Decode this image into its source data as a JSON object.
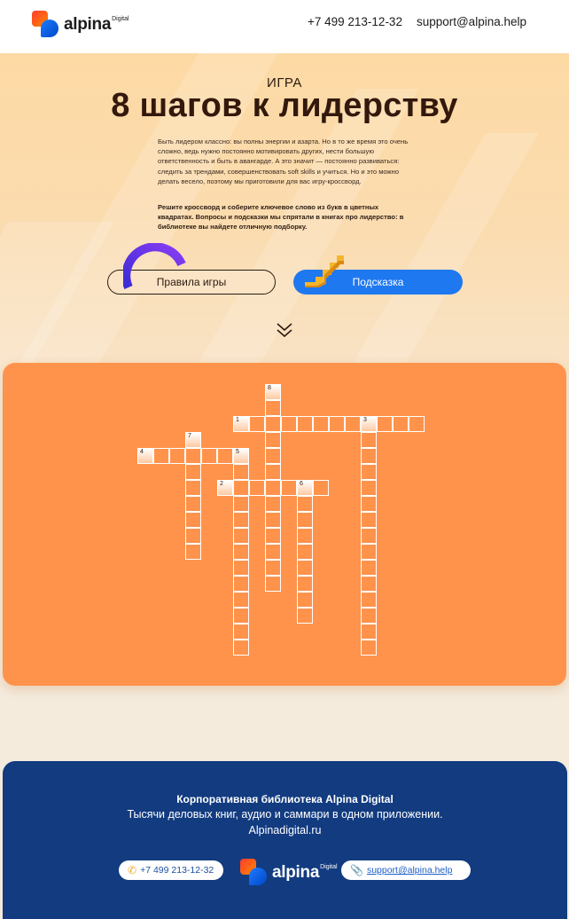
{
  "brand": {
    "name": "alpina",
    "suffix": "Digital"
  },
  "header": {
    "phone": "+7 499 213-12-32",
    "email": "support@alpina.help"
  },
  "hero": {
    "kicker": "ИГРА",
    "title": "8 шагов к лидерству",
    "description": "Быть лидером классно: вы полны энергии и азарта. Но в то же время это очень сложно, ведь нужно постоянно мотивировать других, нести большую ответственность и быть в авангарде. А это значит — постоянно развиваться: следить за трендами, совершенствовать soft skills и учиться. Но и это можно делать весело, поэтому мы приготовили для вас игру-кроссворд.",
    "instructions": "Решите кроссворд и соберите ключевое слово из букв в цветных квадратах. Вопросы и подсказки мы спрятали в книгах про лидерство: в библиотеке вы найдете отличную подборку.",
    "rules_button": "Правила игры",
    "hint_button": "Подсказка",
    "scroll_icon": "double-chevron-down-icon"
  },
  "crossword": {
    "words": [
      {
        "number": "1",
        "direction": "across",
        "col": 14,
        "row": 2,
        "length": 12
      },
      {
        "number": "2",
        "direction": "across",
        "col": 13,
        "row": 6,
        "length": 7
      },
      {
        "number": "3",
        "direction": "down",
        "col": 22,
        "row": 2,
        "length": 15
      },
      {
        "number": "4",
        "direction": "across",
        "col": 8,
        "row": 4,
        "length": 7
      },
      {
        "number": "5",
        "direction": "down",
        "col": 14,
        "row": 4,
        "length": 13
      },
      {
        "number": "6",
        "direction": "down",
        "col": 18,
        "row": 6,
        "length": 9
      },
      {
        "number": "7",
        "direction": "down",
        "col": 11,
        "row": 3,
        "length": 8
      },
      {
        "number": "8",
        "direction": "down",
        "col": 16,
        "row": 0,
        "length": 13
      }
    ],
    "highlight_cells": [
      [
        16,
        0
      ],
      [
        14,
        2
      ],
      [
        22,
        2
      ],
      [
        11,
        3
      ],
      [
        8,
        4
      ],
      [
        14,
        4
      ],
      [
        13,
        6
      ],
      [
        18,
        6
      ]
    ]
  },
  "footer": {
    "title": "Корпоративная библиотека Alpina Digital",
    "subtitle": "Тысячи деловых книг, аудио и саммари в одном приложении.",
    "site": "Alpinadigital.ru",
    "phone": "+7 499 213-12-32",
    "email": "support@alpina.help",
    "phone_icon": "phone-icon",
    "email_icon": "paperclip-icon"
  },
  "colors": {
    "accent_orange": "#ff934c",
    "accent_blue": "#1e78f0",
    "footer_blue": "#123b80"
  }
}
